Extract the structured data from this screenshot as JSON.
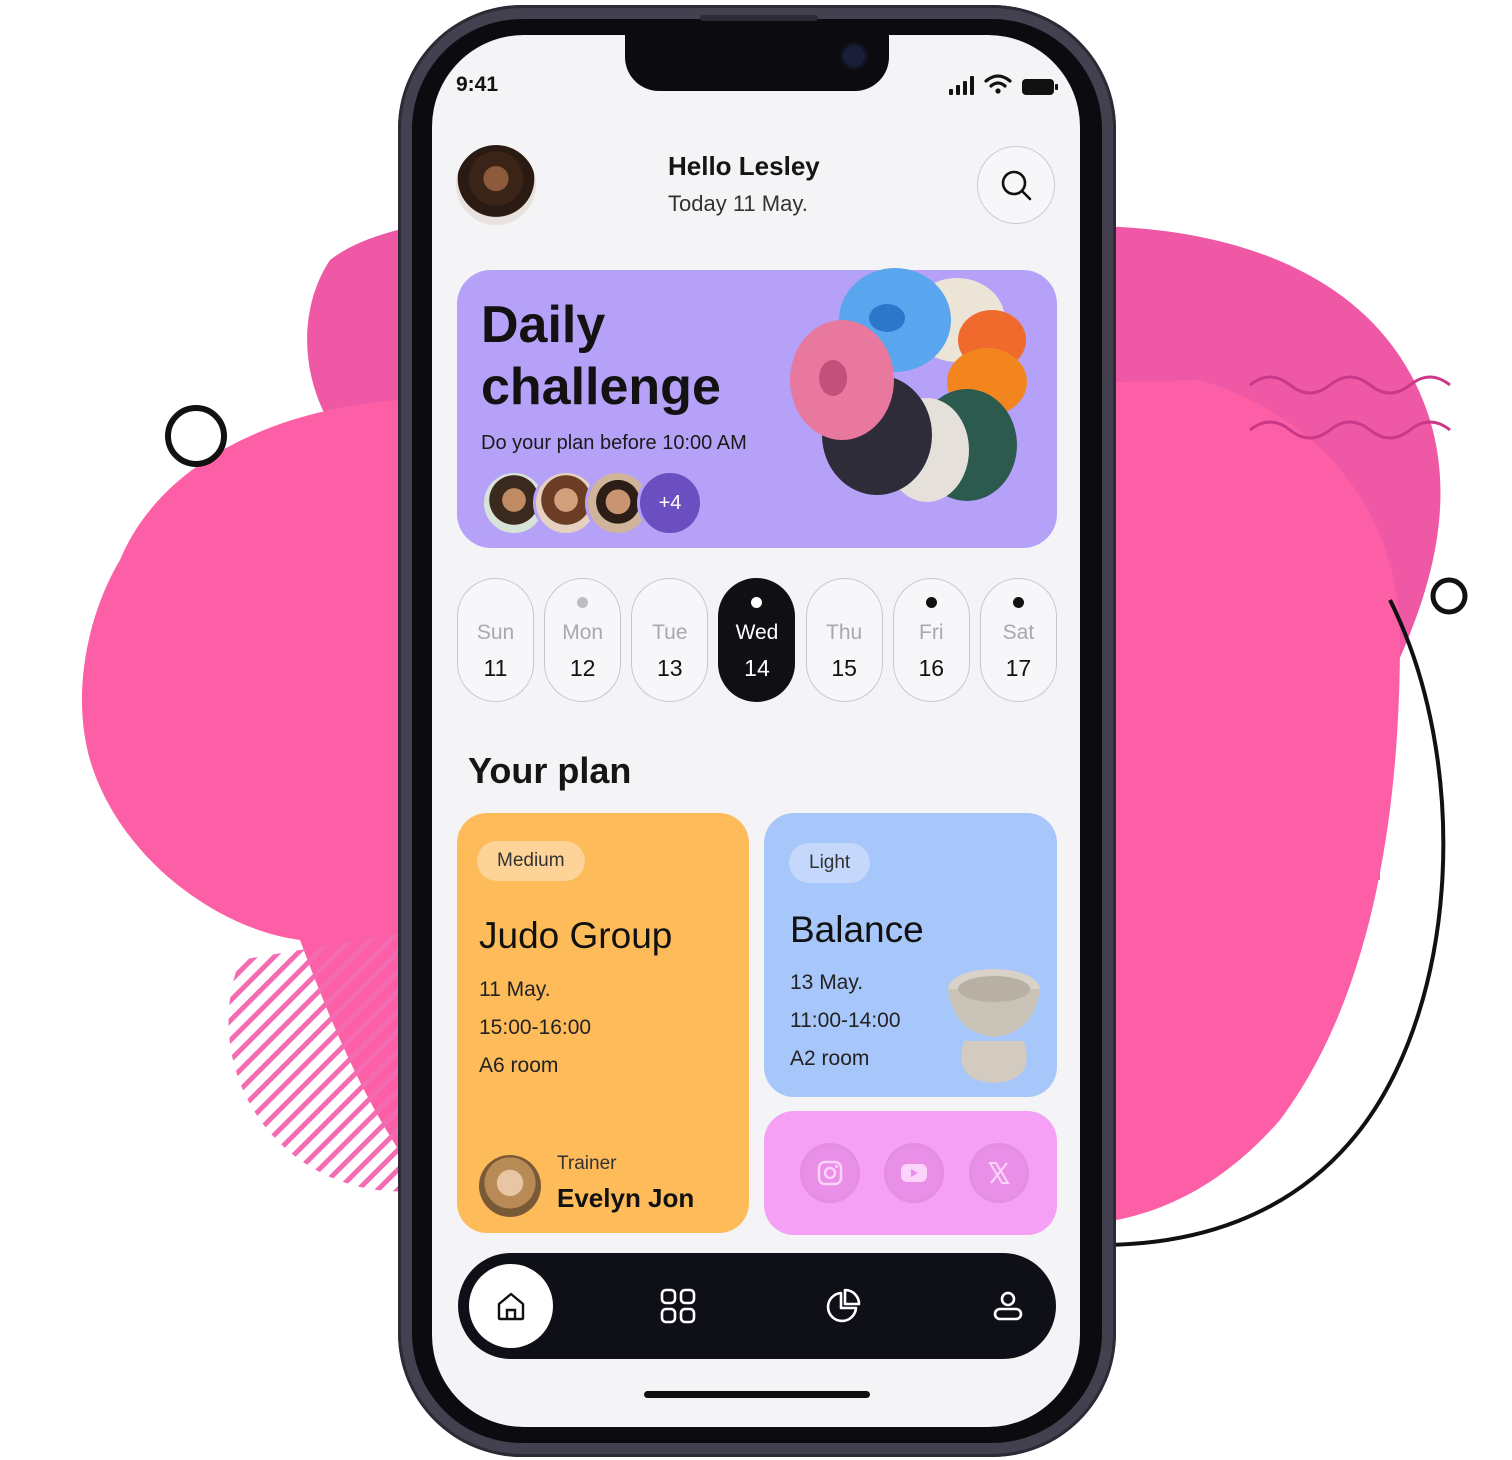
{
  "status": {
    "time": "9:41"
  },
  "header": {
    "greeting": "Hello Lesley",
    "date": "Today 11 May."
  },
  "challenge": {
    "title": "Daily\nchallenge",
    "subtitle": "Do your plan before 10:00 AM",
    "more_participants": "+4"
  },
  "week": [
    {
      "name": "Sun",
      "num": "11",
      "dot": "none",
      "active": false
    },
    {
      "name": "Mon",
      "num": "12",
      "dot": "grey",
      "active": false
    },
    {
      "name": "Tue",
      "num": "13",
      "dot": "none",
      "active": false
    },
    {
      "name": "Wed",
      "num": "14",
      "dot": "white",
      "active": true
    },
    {
      "name": "Thu",
      "num": "15",
      "dot": "none",
      "active": false
    },
    {
      "name": "Fri",
      "num": "16",
      "dot": "black",
      "active": false
    },
    {
      "name": "Sat",
      "num": "17",
      "dot": "black",
      "active": false
    }
  ],
  "plan": {
    "heading": "Your plan",
    "judo": {
      "level": "Medium",
      "title": "Judo Group",
      "date": "11 May.",
      "time": "15:00-16:00",
      "room": "A6 room",
      "trainer_label": "Trainer",
      "trainer_name": "Evelyn Jon"
    },
    "balance": {
      "level": "Light",
      "title": "Balance",
      "date": "13 May.",
      "time": "11:00-14:00",
      "room": "A2 room"
    }
  },
  "social_icons": [
    "instagram-icon",
    "youtube-icon",
    "x-icon"
  ],
  "tabs": [
    "home-icon",
    "grid-icon",
    "pie-chart-icon",
    "user-icon"
  ],
  "colors": {
    "challenge_bg": "#b5a1f8",
    "judo_bg": "#fdbb5a",
    "balance_bg": "#a7c6fa",
    "social_bg": "#f5a0f5",
    "backdrop_pink": "#fd5fa6"
  }
}
